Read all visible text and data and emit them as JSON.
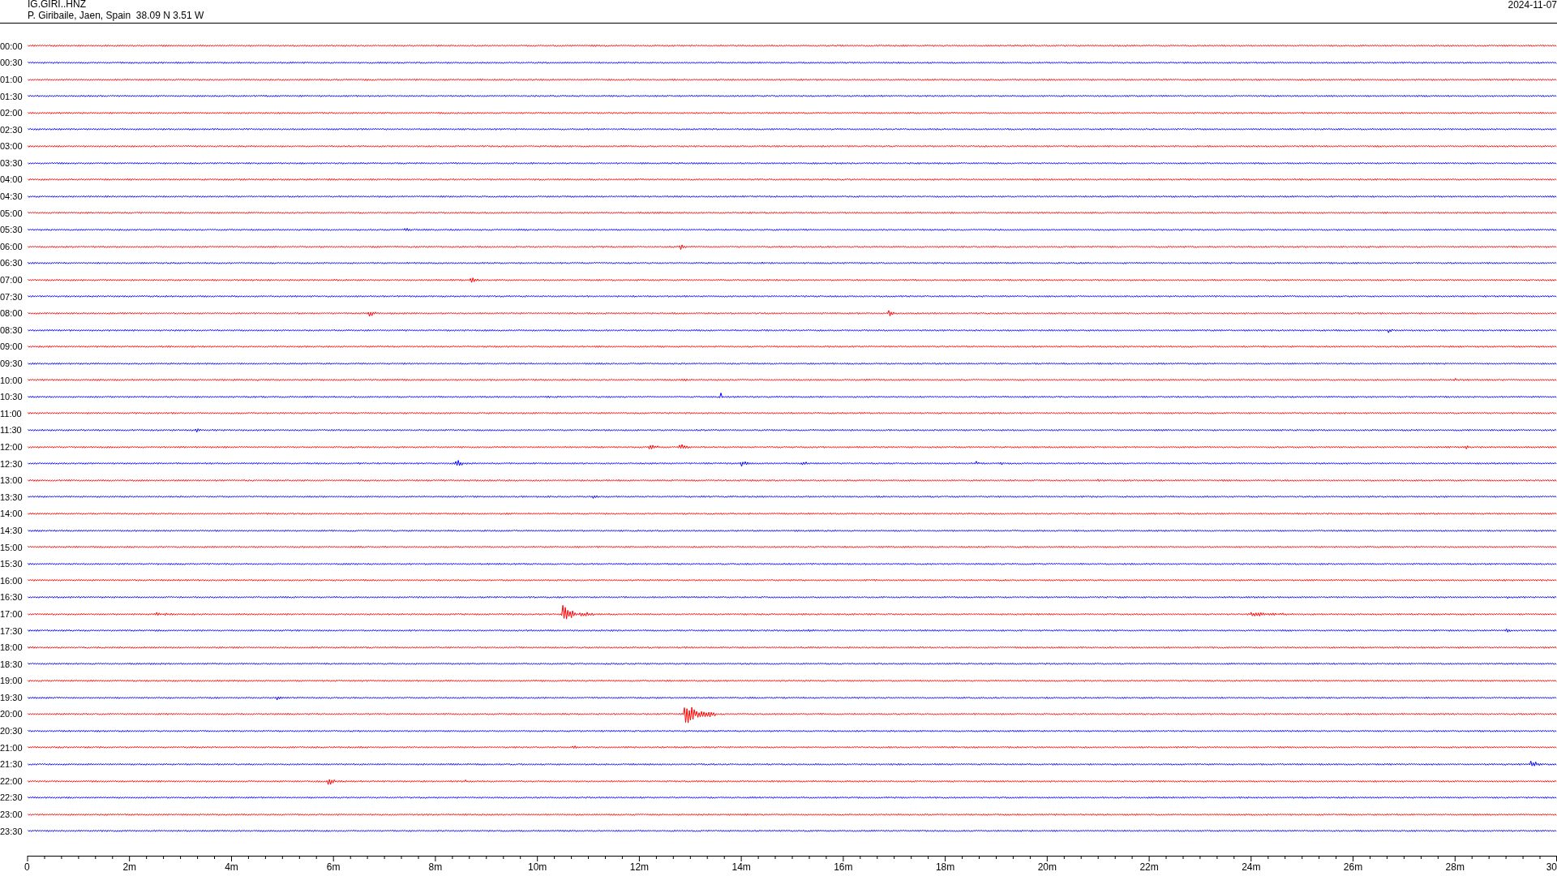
{
  "header": {
    "station": "IG.GIRI..HNZ",
    "location": "P. Giribaile, Jaen, Spain  38.09 N 3.51 W",
    "date": "2024-11-07"
  },
  "rows": [
    {
      "time": "00:00",
      "color": "#ff0000"
    },
    {
      "time": "00:30",
      "color": "#0000ff"
    },
    {
      "time": "01:00",
      "color": "#ff0000"
    },
    {
      "time": "01:30",
      "color": "#0000ff"
    },
    {
      "time": "02:00",
      "color": "#ff0000"
    },
    {
      "time": "02:30",
      "color": "#0000ff"
    },
    {
      "time": "03:00",
      "color": "#ff0000"
    },
    {
      "time": "03:30",
      "color": "#0000ff"
    },
    {
      "time": "04:00",
      "color": "#ff0000"
    },
    {
      "time": "04:30",
      "color": "#0000ff"
    },
    {
      "time": "05:00",
      "color": "#ff0000"
    },
    {
      "time": "05:30",
      "color": "#0000ff"
    },
    {
      "time": "06:00",
      "color": "#ff0000"
    },
    {
      "time": "06:30",
      "color": "#0000ff"
    },
    {
      "time": "07:00",
      "color": "#ff0000"
    },
    {
      "time": "07:30",
      "color": "#0000ff"
    },
    {
      "time": "08:00",
      "color": "#ff0000"
    },
    {
      "time": "08:30",
      "color": "#0000ff"
    },
    {
      "time": "09:00",
      "color": "#ff0000"
    },
    {
      "time": "09:30",
      "color": "#0000ff"
    },
    {
      "time": "10:00",
      "color": "#ff0000"
    },
    {
      "time": "10:30",
      "color": "#0000ff"
    },
    {
      "time": "11:00",
      "color": "#ff0000"
    },
    {
      "time": "11:30",
      "color": "#0000ff"
    },
    {
      "time": "12:00",
      "color": "#ff0000"
    },
    {
      "time": "12:30",
      "color": "#0000ff"
    },
    {
      "time": "13:00",
      "color": "#ff0000"
    },
    {
      "time": "13:30",
      "color": "#0000ff"
    },
    {
      "time": "14:00",
      "color": "#ff0000"
    },
    {
      "time": "14:30",
      "color": "#0000ff"
    },
    {
      "time": "15:00",
      "color": "#ff0000"
    },
    {
      "time": "15:30",
      "color": "#0000ff"
    },
    {
      "time": "16:00",
      "color": "#ff0000"
    },
    {
      "time": "16:30",
      "color": "#0000ff"
    },
    {
      "time": "17:00",
      "color": "#ff0000"
    },
    {
      "time": "17:30",
      "color": "#0000ff"
    },
    {
      "time": "18:00",
      "color": "#ff0000"
    },
    {
      "time": "18:30",
      "color": "#0000ff"
    },
    {
      "time": "19:00",
      "color": "#ff0000"
    },
    {
      "time": "19:30",
      "color": "#0000ff"
    },
    {
      "time": "20:00",
      "color": "#ff0000"
    },
    {
      "time": "20:30",
      "color": "#0000ff"
    },
    {
      "time": "21:00",
      "color": "#ff0000"
    },
    {
      "time": "21:30",
      "color": "#0000ff"
    },
    {
      "time": "22:00",
      "color": "#ff0000"
    },
    {
      "time": "22:30",
      "color": "#0000ff"
    },
    {
      "time": "23:00",
      "color": "#ff0000"
    },
    {
      "time": "23:30",
      "color": "#0000ff"
    }
  ],
  "axis": {
    "labels": [
      "0",
      "2m",
      "4m",
      "6m",
      "8m",
      "10m",
      "12m",
      "14m",
      "16m",
      "18m",
      "20m",
      "22m",
      "24m",
      "26m",
      "28m",
      "30"
    ]
  }
}
